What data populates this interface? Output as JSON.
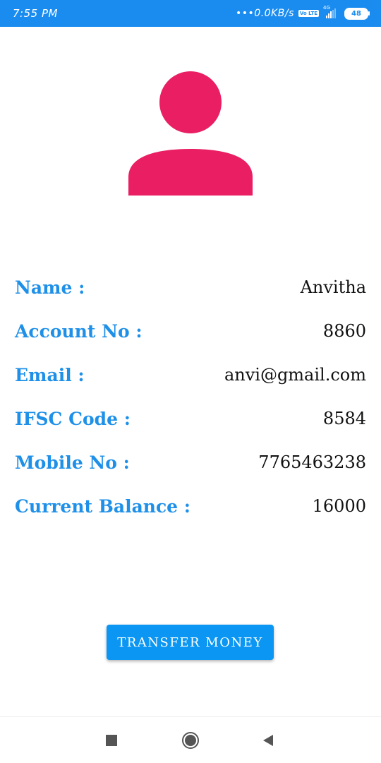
{
  "status_bar": {
    "time": "7:55 PM",
    "net_speed": "0.0KB/s",
    "volte": "Vo LTE",
    "network_gen": "4G",
    "battery": "48",
    "colors": {
      "background": "#1a8cf0"
    }
  },
  "profile": {
    "avatar_icon": "person-icon",
    "avatar_color": "#e91e63"
  },
  "details": [
    {
      "label": "Name :",
      "value": "Anvitha"
    },
    {
      "label": "Account No :",
      "value": "8860"
    },
    {
      "label": "Email :",
      "value": "anvi@gmail.com"
    },
    {
      "label": "IFSC Code :",
      "value": "8584"
    },
    {
      "label": "Mobile No :",
      "value": "7765463238"
    },
    {
      "label": "Current Balance :",
      "value": "16000"
    }
  ],
  "actions": {
    "transfer_label": "TRANSFER MONEY"
  },
  "nav": {
    "recents_icon": "square-icon",
    "home_icon": "circle-icon",
    "back_icon": "triangle-back-icon"
  },
  "colors": {
    "accent": "#1e90e8",
    "button": "#0a96f2"
  }
}
